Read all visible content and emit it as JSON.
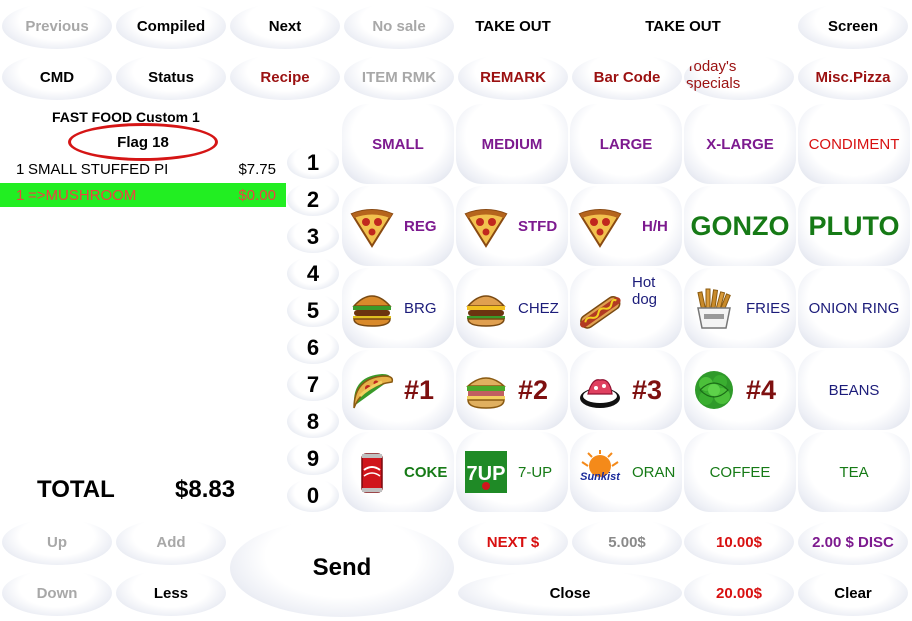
{
  "top_buttons": [
    {
      "label": "Previous",
      "style": "disabled"
    },
    {
      "label": "Compiled",
      "style": ""
    },
    {
      "label": "Next",
      "style": ""
    },
    {
      "label": "No sale",
      "style": "disabled"
    },
    {
      "label": "TAKE OUT",
      "style": ""
    },
    {
      "label": "TAKE OUT",
      "style": ""
    },
    {
      "label": "Screen",
      "style": ""
    }
  ],
  "second_buttons": [
    {
      "label": "CMD",
      "style": ""
    },
    {
      "label": "Status",
      "style": ""
    },
    {
      "label": "Recipe",
      "style": "red"
    },
    {
      "label": "ITEM RMK",
      "style": "disabled"
    },
    {
      "label": "REMARK",
      "style": "red"
    },
    {
      "label": "Bar Code",
      "style": "red"
    },
    {
      "label": "Today's specials",
      "style": "red"
    },
    {
      "label": "Misc.Pizza",
      "style": "red"
    }
  ],
  "order": {
    "header": "FAST FOOD  Custom 1",
    "flag": "Flag 18",
    "items": [
      {
        "qty": "1",
        "description": "SMALL STUFFED PI",
        "price": "$7.75",
        "selected": false
      },
      {
        "qty": "1",
        "description": "=>MUSHROOM",
        "price": "$0.00",
        "selected": true
      }
    ],
    "total_label": "TOTAL",
    "total_value": "$8.83"
  },
  "numpad": [
    "1",
    "2",
    "3",
    "4",
    "5",
    "6",
    "7",
    "8",
    "9",
    "0"
  ],
  "grid": {
    "row1": [
      {
        "label": "SMALL",
        "color": "#7d1a8f"
      },
      {
        "label": "MEDIUM",
        "color": "#7d1a8f"
      },
      {
        "label": "LARGE",
        "color": "#7d1a8f"
      },
      {
        "label": "X-LARGE",
        "color": "#7d1a8f"
      },
      {
        "label": "CONDIMENT",
        "color": "#d81010"
      }
    ],
    "row2": [
      {
        "label": "REG",
        "icon": "pizza-slice-icon",
        "color": "#7d1a8f"
      },
      {
        "label": "STFD",
        "icon": "pizza-slice-icon",
        "color": "#7d1a8f"
      },
      {
        "label": "H/H",
        "icon": "pizza-slice-icon",
        "color": "#7d1a8f"
      },
      {
        "label": "GONZO",
        "color": "#167a16"
      },
      {
        "label": "PLUTO",
        "color": "#167a16"
      }
    ],
    "row3": [
      {
        "label": "BRG",
        "icon": "hamburger-icon",
        "color": "#1c1c7a"
      },
      {
        "label": "CHEZ",
        "icon": "cheeseburger-icon",
        "color": "#1c1c7a"
      },
      {
        "label": "Hot dog",
        "icon": "hotdog-icon",
        "color": "#1c1c7a"
      },
      {
        "label": "FRIES",
        "icon": "fries-icon",
        "color": "#1c1c7a"
      },
      {
        "label": "ONION RING",
        "color": "#1c1c7a"
      }
    ],
    "row4": [
      {
        "label": "#1",
        "icon": "taco-icon",
        "color": "#7e1010"
      },
      {
        "label": "#2",
        "icon": "sandwich-icon",
        "color": "#7e1010"
      },
      {
        "label": "#3",
        "icon": "dessert-icon",
        "color": "#7e1010"
      },
      {
        "label": "#4",
        "icon": "salad-icon",
        "color": "#7e1010"
      },
      {
        "label": "BEANS",
        "color": "#1c1c7a"
      }
    ],
    "row5": [
      {
        "label": "COKE",
        "icon": "coke-can-icon",
        "color": "#167a16"
      },
      {
        "label": "7-UP",
        "icon": "seven-up-logo-icon",
        "color": "#167a16",
        "logo_text": "7UP"
      },
      {
        "label": "ORAN",
        "icon": "sunkist-logo-icon",
        "color": "#167a16",
        "logo_text": "Sunkist"
      },
      {
        "label": "COFFEE",
        "color": "#167a16"
      },
      {
        "label": "TEA",
        "color": "#167a16"
      }
    ]
  },
  "bottom": {
    "up": "Up",
    "add": "Add",
    "send": "Send",
    "down": "Down",
    "less": "Less",
    "next_dollar": "NEXT $",
    "five": "5.00$",
    "ten": "10.00$",
    "disc": "2.00 $ DISC",
    "close": "Close",
    "twenty": "20.00$",
    "clear": "Clear"
  }
}
